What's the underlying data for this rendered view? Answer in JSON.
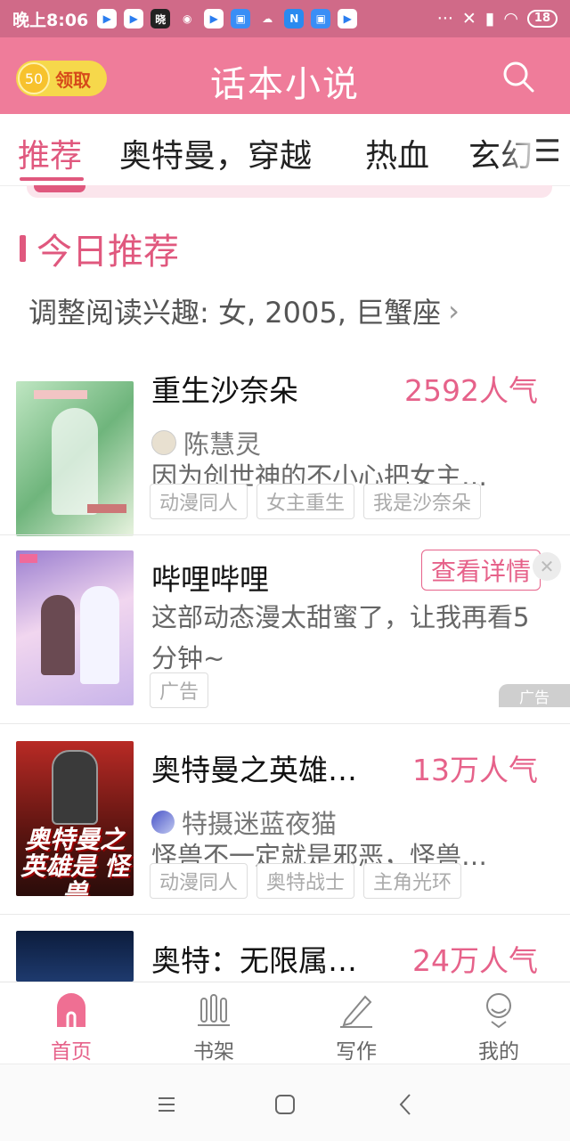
{
  "status_bar": {
    "time": "晚上8:06",
    "apps": [
      "play-store",
      "play-store",
      "xiao",
      "podcast",
      "play-store",
      "app-blue",
      "cloud",
      "n-app",
      "app-blue",
      "play-store"
    ],
    "xiao_label": "晓",
    "more": "···",
    "battery": "18"
  },
  "header": {
    "coin_value": "50",
    "coin_label": "领取",
    "title": "话本小说"
  },
  "tabs": [
    {
      "label": "推荐",
      "active": true
    },
    {
      "label": "奥特曼，穿越"
    },
    {
      "label": "热血"
    },
    {
      "label": "玄幻"
    }
  ],
  "section": {
    "title": "今日推荐",
    "interest": "调整阅读兴趣: 女, 2005, 巨蟹座"
  },
  "books": [
    {
      "title": "重生沙奈朵",
      "popularity": "2592人气",
      "author": "陈慧灵",
      "description": "因为创世神的不小心把女主…",
      "tags": [
        "动漫同人",
        "女主重生",
        "我是沙奈朵"
      ]
    },
    {
      "title": "哔哩哔哩",
      "description": "这部动态漫太甜蜜了，让我再看5分钟~",
      "tags": [
        "广告"
      ],
      "button": "查看详情",
      "ad_mark": "广告",
      "is_ad": true
    },
    {
      "title": "奥特曼之英雄…",
      "popularity": "13万人气",
      "author": "特摄迷蓝夜猫",
      "description": "怪兽不一定就是邪恶，怪兽…",
      "tags": [
        "动漫同人",
        "奥特战士",
        "主角光环"
      ],
      "cover_text": "奥特曼之 英雄是 怪兽"
    },
    {
      "title": "奥特：无限属…",
      "popularity": "24万人气"
    }
  ],
  "bottom_nav": [
    {
      "label": "首页",
      "icon": "home-icon",
      "active": true
    },
    {
      "label": "书架",
      "icon": "bookshelf-icon"
    },
    {
      "label": "写作",
      "icon": "pencil-icon"
    },
    {
      "label": "我的",
      "icon": "profile-icon"
    }
  ],
  "colors": {
    "accent": "#e6628a",
    "header_bg": "#ef7c9a",
    "status_bg": "#d06a88"
  }
}
